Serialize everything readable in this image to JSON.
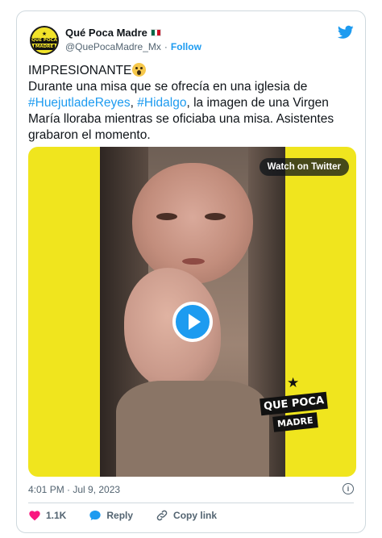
{
  "author": {
    "display_name": "Qué Poca Madre",
    "handle": "@QuePocaMadre_Mx",
    "follow_label": "Follow",
    "flag_icon": "mexico-flag-icon",
    "avatar_lines": [
      "QUÉ POCA",
      "MADRE"
    ]
  },
  "tweet": {
    "line1": "IMPRESIONANTE",
    "emoji": "face-screaming-emoji",
    "text_part1": "Durante una misa que se ofrecía en una iglesia de ",
    "hashtag1": "#HuejutladeReyes",
    "text_sep": ", ",
    "hashtag2": "#Hidalgo",
    "text_part2": ", la imagen de una Virgen María lloraba mientras se oficiaba una misa. Asistentes grabaron el momento."
  },
  "media": {
    "watch_label": "Watch on Twitter",
    "logo_line1": "QUE POCA",
    "logo_line2": "MADRE",
    "background_color": "#f0e51e"
  },
  "footer": {
    "timestamp": "4:01 PM · Jul 9, 2023",
    "likes": "1.1K",
    "reply_label": "Reply",
    "copy_link_label": "Copy link"
  },
  "colors": {
    "accent": "#1d9bf0",
    "like": "#f91880",
    "text_secondary": "#536471"
  }
}
